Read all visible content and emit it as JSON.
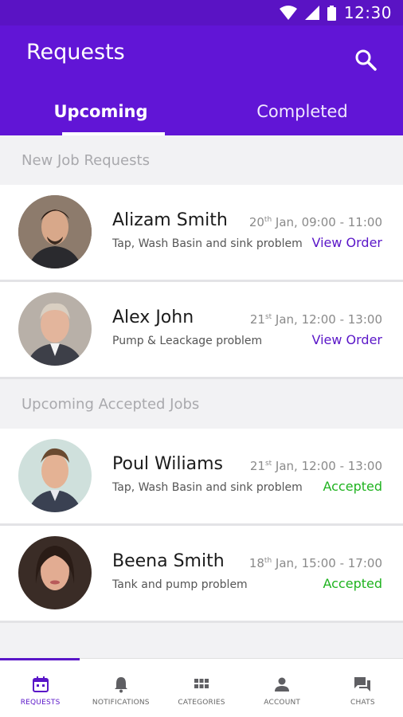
{
  "status_bar": {
    "time": "12:30"
  },
  "header": {
    "title": "Requests"
  },
  "tabs": [
    {
      "label": "Upcoming",
      "active": true
    },
    {
      "label": "Completed",
      "active": false
    }
  ],
  "sections": {
    "new": {
      "title": "New Job Requests",
      "items": [
        {
          "name": "Alizam Smith",
          "problem": "Tap, Wash Basin and sink problem",
          "day": "20",
          "suffix": "th",
          "date_rest": " Jan, 09:00 - 11:00",
          "action": "View Order"
        },
        {
          "name": "Alex John",
          "problem": "Pump & Leackage problem",
          "day": "21",
          "suffix": "st",
          "date_rest": " Jan, 12:00 - 13:00",
          "action": "View Order"
        }
      ]
    },
    "accepted": {
      "title": "Upcoming Accepted Jobs",
      "items": [
        {
          "name": "Poul Wiliams",
          "problem": "Tap, Wash Basin and sink problem",
          "day": "21",
          "suffix": "st",
          "date_rest": " Jan, 12:00 - 13:00",
          "action": "Accepted"
        },
        {
          "name": "Beena Smith",
          "problem": "Tank and pump problem",
          "day": "18",
          "suffix": "th",
          "date_rest": " Jan, 15:00 - 17:00",
          "action": "Accepted"
        }
      ]
    }
  },
  "bottom_nav": [
    {
      "label": "REQUESTS",
      "icon": "calendar-icon",
      "active": true
    },
    {
      "label": "NOTIFICATIONS",
      "icon": "bell-icon",
      "active": false
    },
    {
      "label": "CATEGORIES",
      "icon": "grid-icon",
      "active": false
    },
    {
      "label": "ACCOUNT",
      "icon": "person-icon",
      "active": false
    },
    {
      "label": "CHATS",
      "icon": "chat-icon",
      "active": false
    }
  ],
  "colors": {
    "primary": "#6115d6",
    "status_bar": "#5a13c4",
    "accent": "#5a16c8",
    "accepted": "#1fb31f"
  }
}
